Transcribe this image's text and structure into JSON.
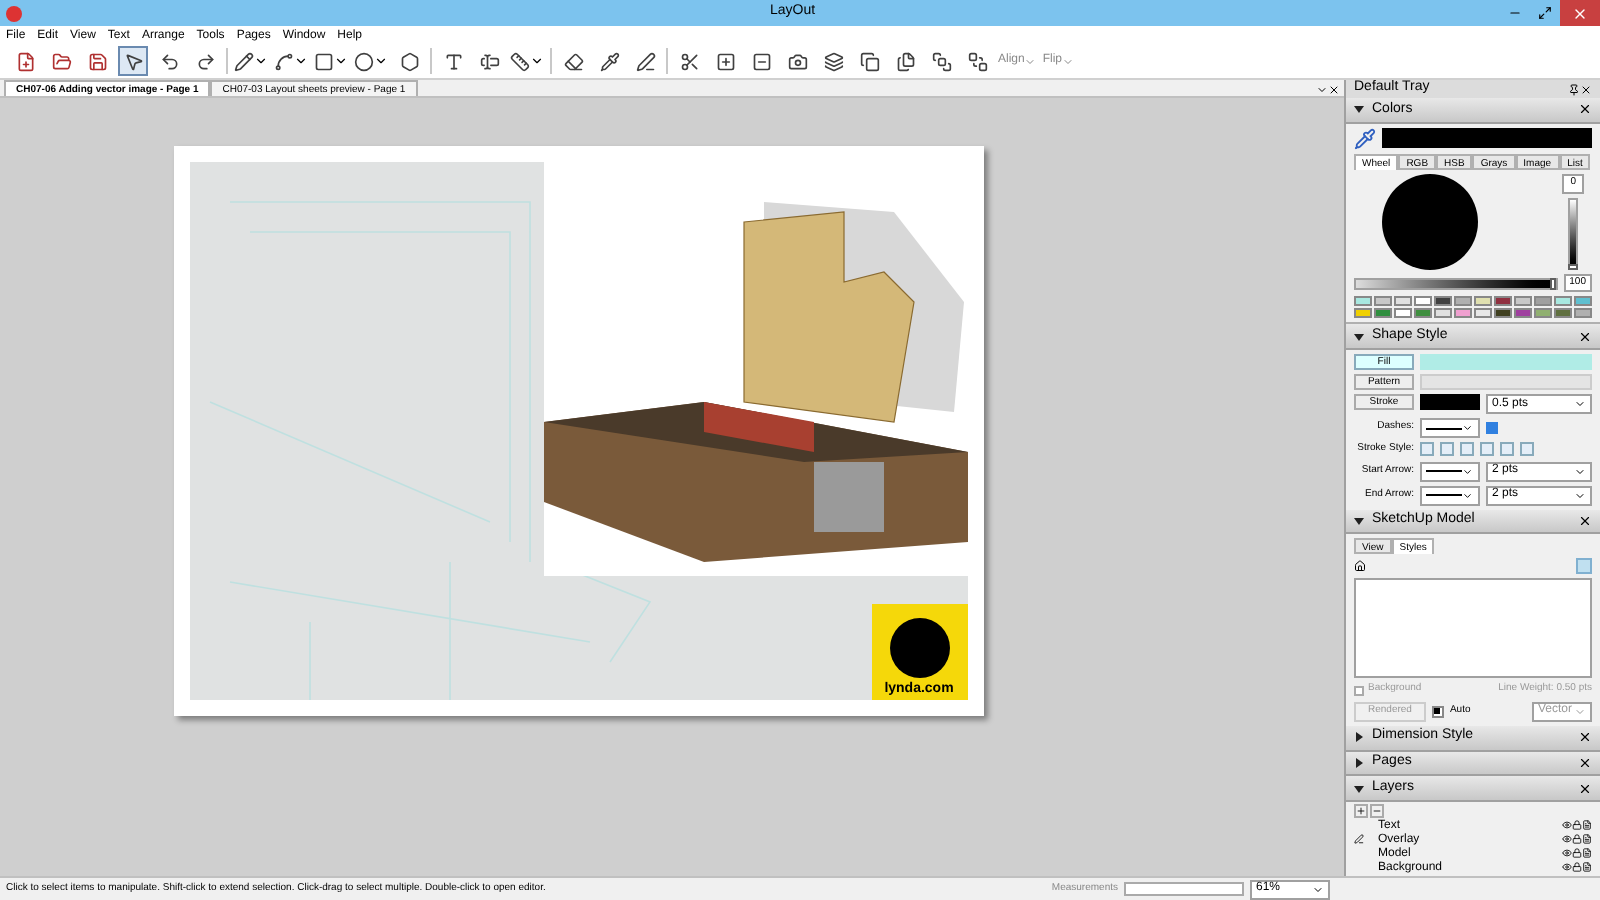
{
  "window": {
    "title": "LayOut"
  },
  "menu": [
    "File",
    "Edit",
    "View",
    "Text",
    "Arrange",
    "Tools",
    "Pages",
    "Window",
    "Help"
  ],
  "toolbar": {
    "tools": [
      {
        "kind": "button",
        "selected": false
      },
      {
        "kind": "button",
        "selected": false
      },
      {
        "kind": "button",
        "selected": false
      },
      {
        "kind": "button",
        "selected": true
      },
      {
        "kind": "button",
        "selected": false
      },
      {
        "kind": "button",
        "selected": false
      },
      {
        "kind": "dropdown",
        "selected": false
      },
      {
        "kind": "dropdown",
        "selected": false
      },
      {
        "kind": "dropdown",
        "selected": false
      },
      {
        "kind": "dropdown",
        "selected": false
      },
      {
        "kind": "button",
        "selected": false
      },
      {
        "kind": "button",
        "selected": false
      },
      {
        "kind": "button",
        "selected": false
      },
      {
        "kind": "dropdown",
        "selected": false
      },
      {
        "kind": "button",
        "selected": false
      },
      {
        "kind": "button",
        "selected": false
      },
      {
        "kind": "button",
        "selected": false
      },
      {
        "kind": "button",
        "selected": false
      },
      {
        "kind": "button",
        "selected": false
      },
      {
        "kind": "button",
        "selected": false
      },
      {
        "kind": "button",
        "selected": false
      },
      {
        "kind": "button",
        "selected": false
      },
      {
        "kind": "button",
        "selected": false
      },
      {
        "kind": "button",
        "selected": false
      },
      {
        "kind": "button",
        "selected": false
      },
      {
        "kind": "button",
        "selected": false
      }
    ],
    "align": "Align",
    "flip": "Flip"
  },
  "tabs": [
    {
      "label": "CH07-06 Adding vector image - Page 1",
      "selected": true
    },
    {
      "label": "CH07-03 Layout sheets preview - Page 1",
      "selected": false
    }
  ],
  "page": {
    "logo_text": "lynda.com"
  },
  "tray": {
    "title": "Default Tray",
    "colors": {
      "title": "Colors",
      "expanded": true,
      "tabs": [
        {
          "label": "Wheel",
          "selected": true
        },
        {
          "label": "RGB",
          "selected": false
        },
        {
          "label": "HSB",
          "selected": false
        },
        {
          "label": "Grays",
          "selected": false
        },
        {
          "label": "Image",
          "selected": false
        },
        {
          "label": "List",
          "selected": false
        }
      ],
      "brightness": {
        "value": "0",
        "level": 0
      },
      "opacity": {
        "value": "100",
        "level": 1
      },
      "swatches": [
        {
          "color": "#a8e8e0"
        },
        {
          "color": "#c8c8c8"
        },
        {
          "color": "#e0e0e0"
        },
        {
          "color": "#ffffff"
        },
        {
          "color": "#404040"
        },
        {
          "color": "#b0b0b0"
        },
        {
          "color": "#e0e0b0"
        },
        {
          "color": "#903040"
        },
        {
          "color": "#c8c8c8"
        },
        {
          "color": "#a0a0a0"
        },
        {
          "color": "#a8e8e0"
        },
        {
          "color": "#60c0d0"
        },
        {
          "color": "#f0d000"
        },
        {
          "color": "#2f8f3f"
        },
        {
          "color": "#ffffff"
        },
        {
          "color": "#3f8f3f"
        },
        {
          "color": "#e0e0e0"
        },
        {
          "color": "#f0a0d0"
        },
        {
          "color": "#e8e8e8"
        },
        {
          "color": "#404020"
        },
        {
          "color": "#a040a0"
        },
        {
          "color": "#90b070"
        },
        {
          "color": "#607040"
        },
        {
          "color": "#b0b0b0"
        }
      ]
    },
    "shape_style": {
      "title": "Shape Style",
      "expanded": true,
      "fill": "Fill",
      "pattern": "Pattern",
      "stroke": "Stroke",
      "stroke_width": "0.5 pts",
      "dashes": "Dashes:",
      "stroke_style": "Stroke Style:",
      "start_arrow": "Start Arrow:",
      "start_size": "2 pts",
      "end_arrow": "End Arrow:",
      "end_size": "2 pts"
    },
    "sketchup_model": {
      "title": "SketchUp Model",
      "expanded": true,
      "tabs": [
        {
          "label": "View",
          "selected": false
        },
        {
          "label": "Styles",
          "selected": true
        }
      ],
      "background": {
        "label": "Background",
        "checked": false
      },
      "line_weight": "Line Weight: 0.50 pts",
      "rendered": "Rendered",
      "auto": {
        "label": "Auto",
        "checked": true
      },
      "vector": "Vector"
    },
    "collapsed": [
      {
        "title": "Dimension Style",
        "expanded": false
      },
      {
        "title": "Pages",
        "expanded": false
      }
    ],
    "layers": {
      "title": "Layers",
      "expanded": true,
      "items": [
        {
          "name": "Text",
          "current": false
        },
        {
          "name": "Overlay",
          "current": true
        },
        {
          "name": "Model",
          "current": false
        },
        {
          "name": "Background",
          "current": false
        }
      ]
    }
  },
  "status_bar": {
    "hint": "Click to select items to manipulate. Shift-click to extend selection. Click-drag to select multiple. Double-click to open editor.",
    "measurements": "Measurements",
    "zoom": "61%"
  }
}
